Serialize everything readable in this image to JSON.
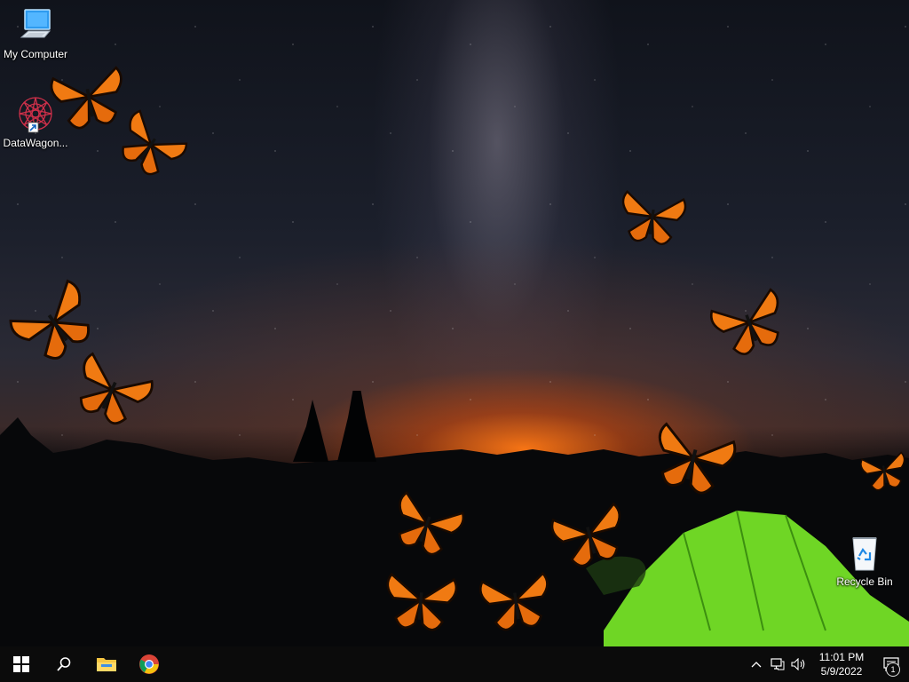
{
  "desktop": {
    "icons": [
      {
        "label": "My Computer",
        "icon": "computer-icon"
      },
      {
        "label": "DataWagon...",
        "icon": "datawagon-shortcut-icon"
      },
      {
        "label": "Recycle Bin",
        "icon": "recycle-bin-icon"
      }
    ],
    "wallpaper": "night-sky-milky-way-tent-butterflies"
  },
  "taskbar": {
    "buttons": [
      {
        "name": "start",
        "icon": "windows-logo-icon"
      },
      {
        "name": "search",
        "icon": "search-icon"
      },
      {
        "name": "file-explorer",
        "icon": "folder-icon"
      },
      {
        "name": "chrome",
        "icon": "chrome-icon"
      }
    ],
    "tray": {
      "icons": [
        "chevron-up-icon",
        "network-icon",
        "volume-icon"
      ],
      "time": "11:01 PM",
      "date": "5/9/2022",
      "notification_count": "1"
    }
  },
  "colors": {
    "taskbar": "#0b0b0b",
    "butterfly": "#f07a12",
    "tent": "#7ee52a"
  }
}
